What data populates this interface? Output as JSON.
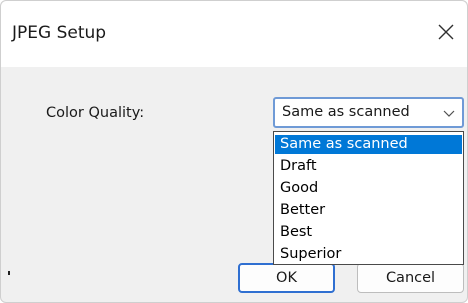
{
  "dialog": {
    "title": "JPEG Setup",
    "close_glyph": "✕",
    "close_icon": "close-icon"
  },
  "field": {
    "label": "Color Quality:",
    "selected_value": "Same as scanned",
    "arrow_icon": "chevron-down-icon"
  },
  "dropdown": {
    "options": [
      "Same as scanned",
      "Draft",
      "Good",
      "Better",
      "Best",
      "Superior"
    ],
    "highlighted": "Same as scanned"
  },
  "buttons": {
    "ok_label": "OK",
    "cancel_label": "Cancel"
  },
  "colors": {
    "highlight": "#0078d7",
    "focus_border": "#2f6fd1"
  }
}
